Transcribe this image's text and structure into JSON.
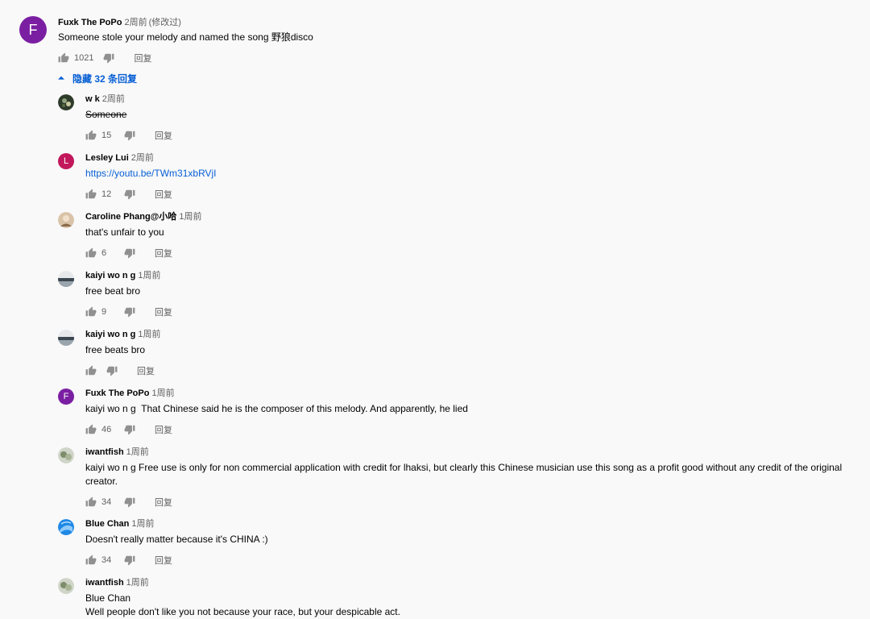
{
  "top_comment": {
    "avatar_letter": "F",
    "author": "Fuxk The PoPo",
    "time": "2周前",
    "edited": "(修改过)",
    "text": "Someone stole your melody and named the song 野狼disco",
    "likes": "1021",
    "reply_label": "回复"
  },
  "replies_toggle": {
    "label": "隐藏 32 条回复"
  },
  "colors": {
    "link": "#065fd4",
    "avatar_purple": "#7b1fa2",
    "avatar_red": "#c2185b"
  },
  "replies": [
    {
      "author": "w k",
      "time": "2周前",
      "text": "Someone",
      "likes": "15",
      "reply_label": "回复"
    },
    {
      "avatar_letter": "L",
      "author": "Lesley Lui",
      "time": "2周前",
      "text": "https://youtu.be/TWm31xbRVjI",
      "likes": "12",
      "reply_label": "回复"
    },
    {
      "author": "Caroline Phang@小哈",
      "time": "1周前",
      "text": "that's unfair to you",
      "likes": "6",
      "reply_label": "回复"
    },
    {
      "author": "kaiyi wo n g",
      "time": "1周前",
      "text": "free beat bro",
      "likes": "9",
      "reply_label": "回复"
    },
    {
      "author": "kaiyi wo n g",
      "time": "1周前",
      "text": "free beats bro",
      "likes": "",
      "reply_label": "回复"
    },
    {
      "avatar_letter": "F",
      "author": "Fuxk The PoPo",
      "time": "1周前",
      "text": "kaiyi wo n g  That Chinese said he is the composer of this melody. And apparently, he lied",
      "likes": "46",
      "reply_label": "回复"
    },
    {
      "author": "iwantfish",
      "time": "1周前",
      "text": "kaiyi wo n g Free use is only for non commercial application with credit for lhaksi, but clearly this Chinese musician use this song as a profit good without any credit of the original creator.",
      "likes": "34",
      "reply_label": "回复"
    },
    {
      "author": "Blue Chan",
      "time": "1周前",
      "text": "Doesn't really matter because it's CHINA :)",
      "likes": "34",
      "reply_label": "回复"
    },
    {
      "author": "iwantfish",
      "time": "1周前",
      "text_line1": "Blue Chan",
      "text_line2": "Well people don't like you not because your race, but your despicable act."
    }
  ]
}
